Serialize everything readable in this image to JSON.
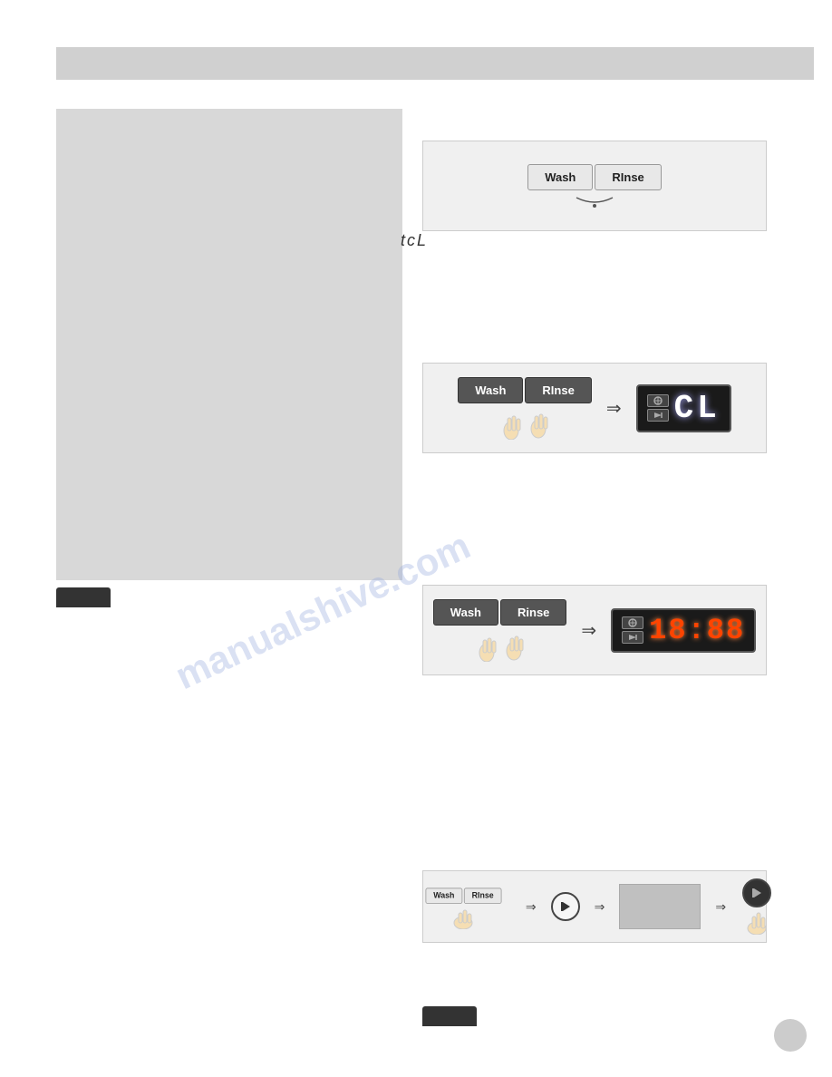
{
  "header": {
    "title": ""
  },
  "leftPanel": {
    "label": "tcL"
  },
  "boxes": {
    "box1": {
      "washLabel": "Wash",
      "rinseLabel": "RInse"
    },
    "box2": {
      "washLabel": "Wash",
      "rinseLabel": "RInse",
      "displayText": "CL"
    },
    "box3": {
      "washLabel": "Wash",
      "rinseLabel": "Rinse",
      "displayText": "18:88"
    },
    "box4": {
      "washLabel": "Wash",
      "rinseLabel": "RInse"
    }
  },
  "watermark": "manualshive.com",
  "pageNumber": ""
}
